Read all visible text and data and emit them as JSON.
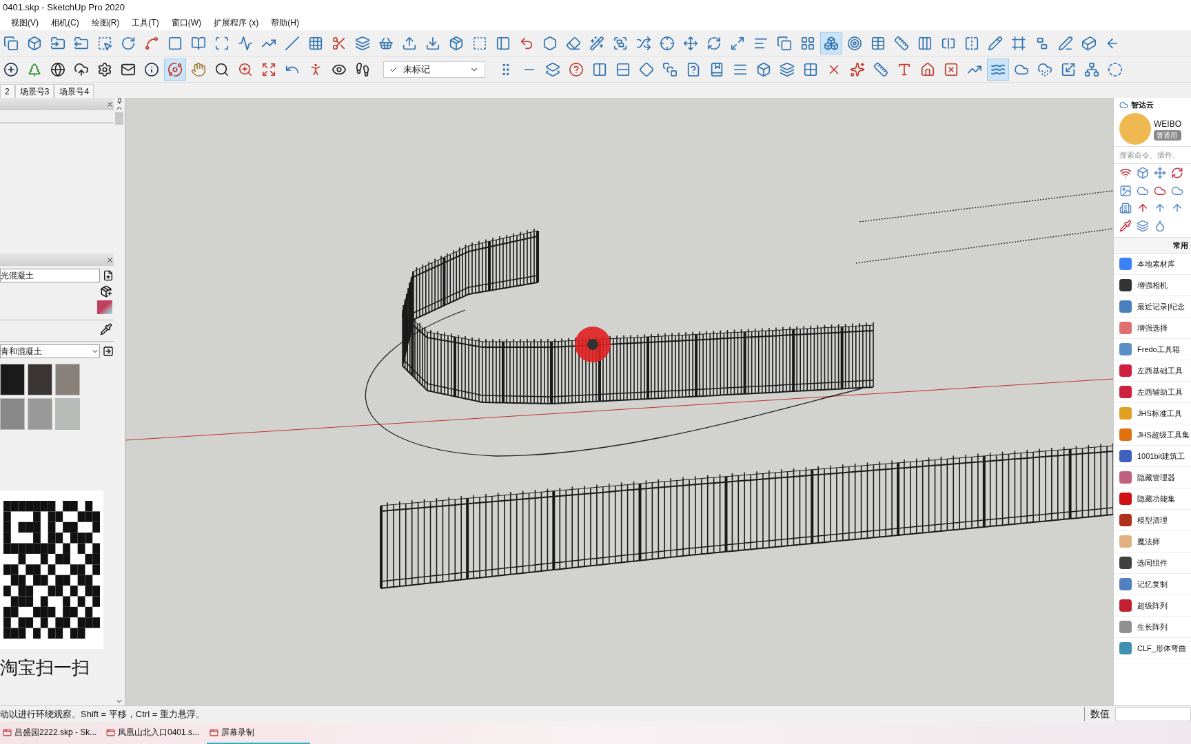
{
  "window": {
    "title": "0401.skp - SketchUp Pro 2020"
  },
  "menu": [
    "视图(V)",
    "相机(C)",
    "绘图(R)",
    "工具(T)",
    "窗口(W)",
    "扩展程序 (x)",
    "帮助(H)"
  ],
  "tag_dropdown": {
    "value": "未标记"
  },
  "scene_tabs": [
    "2",
    "场景号3",
    "场景号4"
  ],
  "materials_panel": {
    "material_name": "光混凝土",
    "library": "青和混凝土",
    "qr_caption": "淘宝扫一扫"
  },
  "plugin_panel": {
    "brand": "智达云",
    "user": "WEIBO",
    "badge": "普通用",
    "search": {
      "placeholder": "搜索命令、插件、"
    },
    "section": "常用",
    "items": [
      {
        "label": "本地素材库",
        "color": "#3b82f6"
      },
      {
        "label": "增强相机",
        "color": "#333333"
      },
      {
        "label": "最近记录|纪念",
        "color": "#4a7fc0"
      },
      {
        "label": "增强选择",
        "color": "#e07070"
      },
      {
        "label": "Fredo工具箱",
        "color": "#5a8fc8"
      },
      {
        "label": "左西基础工具",
        "color": "#d02040"
      },
      {
        "label": "左西辅助工具",
        "color": "#d02040"
      },
      {
        "label": "JHS标准工具",
        "color": "#e0a020"
      },
      {
        "label": "JHS超级工具集",
        "color": "#e07010"
      },
      {
        "label": "1001bit建筑工",
        "color": "#4060c0"
      },
      {
        "label": "隐藏管理器",
        "color": "#c06080"
      },
      {
        "label": "隐藏功能集",
        "color": "#d01010"
      },
      {
        "label": "模型清理",
        "color": "#b03020"
      },
      {
        "label": "魔法师",
        "color": "#e0b080"
      },
      {
        "label": "选同组件",
        "color": "#404040"
      },
      {
        "label": "记忆复制",
        "color": "#5080c0"
      },
      {
        "label": "超级阵列",
        "color": "#c02030"
      },
      {
        "label": "生长阵列",
        "color": "#909090"
      },
      {
        "label": "CLF_形体弯曲",
        "color": "#4090b0"
      }
    ]
  },
  "status_bar": {
    "hint": "动以进行环绕观察。Shift = 平移，Ctrl = 重力悬浮。",
    "value_label": "数值"
  },
  "taskbar": [
    {
      "label": "昌盛园2222.skp - Sk...",
      "selected": false
    },
    {
      "label": "凤凰山北入口0401.s...",
      "selected": false
    },
    {
      "label": "屏幕录制",
      "selected": true
    }
  ]
}
